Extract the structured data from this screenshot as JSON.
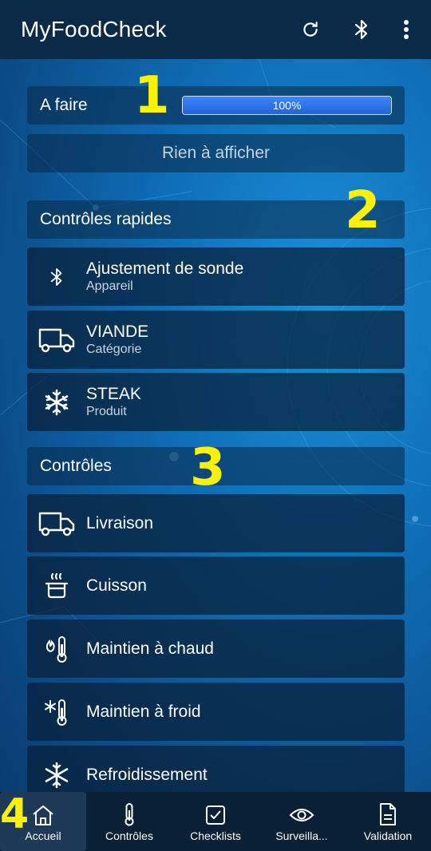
{
  "app": {
    "title": "MyFoodCheck"
  },
  "appbar": {
    "icons": [
      "refresh-icon",
      "bluetooth-icon",
      "more-vert-icon"
    ]
  },
  "todo": {
    "label": "A faire",
    "progress_percent": 100,
    "progress_text": "100%",
    "empty_text": "Rien à afficher"
  },
  "quick": {
    "header": "Contrôles rapides",
    "items": [
      {
        "title": "Ajustement de sonde",
        "subtitle": "Appareil",
        "icon": "bluetooth-icon"
      },
      {
        "title": "VIANDE",
        "subtitle": "Catégorie",
        "icon": "truck-icon"
      },
      {
        "title": "STEAK",
        "subtitle": "Produit",
        "icon": "snowflake-icon"
      }
    ]
  },
  "controls": {
    "header": "Contrôles",
    "items": [
      {
        "title": "Livraison",
        "icon": "truck-icon"
      },
      {
        "title": "Cuisson",
        "icon": "cooking-pot-icon"
      },
      {
        "title": "Maintien à chaud",
        "icon": "hot-thermometer-icon"
      },
      {
        "title": "Maintien à froid",
        "icon": "cold-thermometer-icon"
      },
      {
        "title": "Refroidissement",
        "icon": "snowflake-icon"
      }
    ]
  },
  "markers": [
    "1",
    "2",
    "3",
    "4"
  ],
  "nav": {
    "items": [
      {
        "label": "Accueil",
        "icon": "home-icon",
        "active": true
      },
      {
        "label": "Contrôles",
        "icon": "thermometer-icon",
        "active": false
      },
      {
        "label": "Checklists",
        "icon": "checkbox-icon",
        "active": false
      },
      {
        "label": "Surveilla...",
        "icon": "eye-icon",
        "active": false
      },
      {
        "label": "Validation",
        "icon": "document-icon",
        "active": false
      }
    ]
  },
  "colors": {
    "appbar": "#0a2a48",
    "accent": "#2a6de8",
    "marker": "#fff200"
  }
}
